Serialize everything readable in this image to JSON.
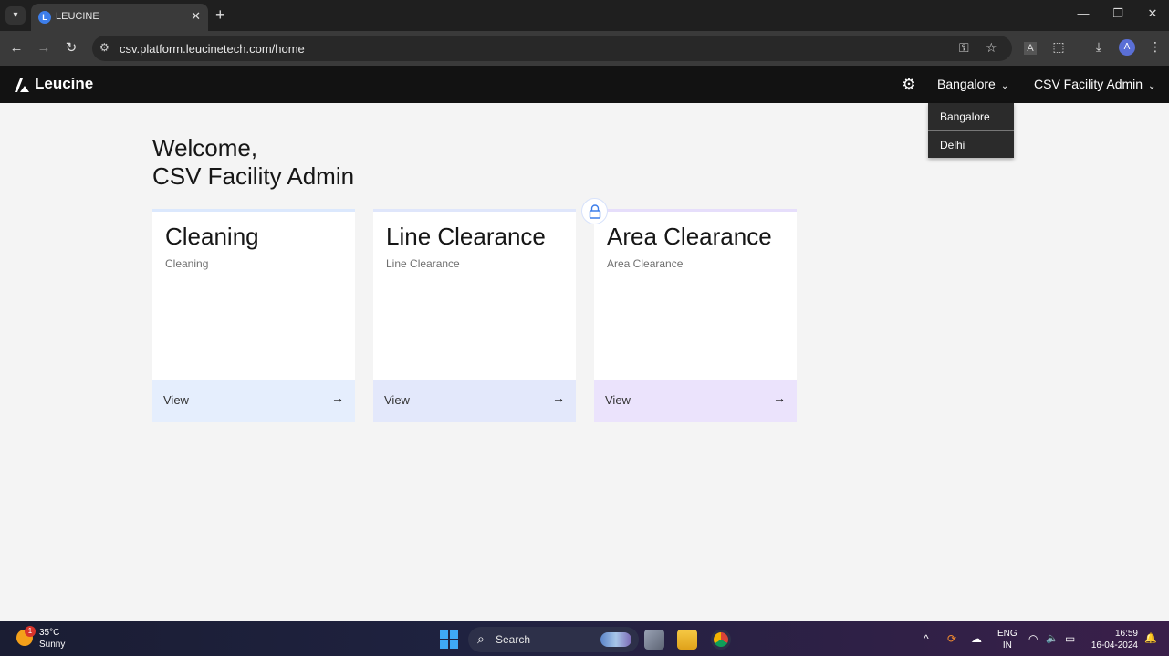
{
  "browser": {
    "tab_title": "LEUCINE",
    "tab_favicon": "L",
    "url": "csv.platform.leucinetech.com/home",
    "profile_initial": "A",
    "icons": {
      "tab_list": "▾",
      "tab_close": "✕",
      "new_tab": "+",
      "minimize": "—",
      "restore": "❐",
      "close": "✕",
      "back": "←",
      "forward": "→",
      "reload": "↻",
      "site_info": "⚙",
      "password_key": "⚿",
      "bookmark_star": "☆",
      "translate": "A",
      "extensions": "⬚",
      "download": "⤓",
      "menu": "⋮"
    }
  },
  "header": {
    "logo_text": "Leucine",
    "settings_icon": "⚙",
    "facility": "Bangalore",
    "user": "CSV Facility Admin",
    "chevron": "⌄"
  },
  "facility_dropdown": {
    "options": [
      "Bangalore",
      "Delhi"
    ]
  },
  "welcome": {
    "line1": "Welcome,",
    "line2": "CSV Facility Admin"
  },
  "cards": [
    {
      "title": "Cleaning",
      "subtitle": "Cleaning",
      "action": "View",
      "accent": "#dbe8fd",
      "footer_bg": "#e5eefd"
    },
    {
      "title": "Line Clearance",
      "subtitle": "Line Clearance",
      "action": "View",
      "accent": "#dfe6fb",
      "footer_bg": "#e3e8fb"
    },
    {
      "title": "Area Clearance",
      "subtitle": "Area Clearance",
      "action": "View",
      "accent": "#e6defb",
      "footer_bg": "#ebe3fc"
    }
  ],
  "arrow_icon": "→",
  "lock_icon": "lock",
  "taskbar": {
    "temperature": "35°C",
    "condition": "Sunny",
    "weather_badge": "1",
    "search_label": "Search",
    "search_icon": "⌕",
    "lang_line1": "ENG",
    "lang_line2": "IN",
    "time": "16:59",
    "date": "16-04-2024",
    "tray_icons": {
      "chevron_up": "^",
      "sync": "⟳",
      "cloud": "☁",
      "wifi": "◠",
      "volume": "🔈",
      "battery": "▭",
      "notifications": "🔔"
    }
  }
}
